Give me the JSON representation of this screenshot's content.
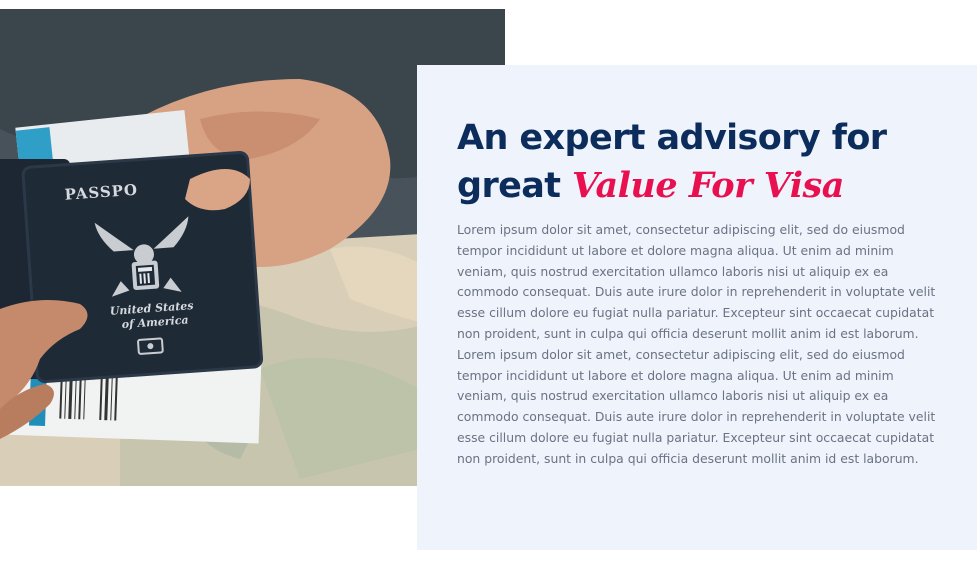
{
  "heading": {
    "line1": "An expert advisory for",
    "line2_prefix": "great",
    "line2_accent": "Value For Visa"
  },
  "paragraph": "Lorem ipsum dolor sit amet, consectetur adipiscing elit, sed do eiusmod tempor incididunt ut labore et dolore magna aliqua. Ut enim ad minim veniam, quis nostrud exercitation ullamco laboris nisi ut aliquip ex ea commodo consequat. Duis aute irure dolor in reprehenderit in voluptate velit esse cillum dolore eu fugiat nulla pariatur. Excepteur sint occaecat cupidatat non proident, sunt in culpa qui officia deserunt mollit anim id est laborum. Lorem ipsum dolor sit amet, consectetur adipiscing elit, sed do eiusmod tempor incididunt ut labore et dolore magna aliqua. Ut enim ad minim veniam, quis nostrud exercitation ullamco laboris nisi ut aliquip ex ea commodo consequat. Duis aute irure dolor in reprehenderit in voluptate velit esse cillum dolore eu fugiat nulla pariatur. Excepteur sint occaecat cupidatat non proident, sunt in culpa qui officia deserunt mollit anim id est laborum.",
  "passport": {
    "cover_text": "PASSPO",
    "country_line1": "United States",
    "country_line2": "of America"
  },
  "colors": {
    "heading": "#0c2d5c",
    "accent": "#e8104f",
    "panel_bg": "#eef3fc",
    "body_text": "#6b7282"
  }
}
